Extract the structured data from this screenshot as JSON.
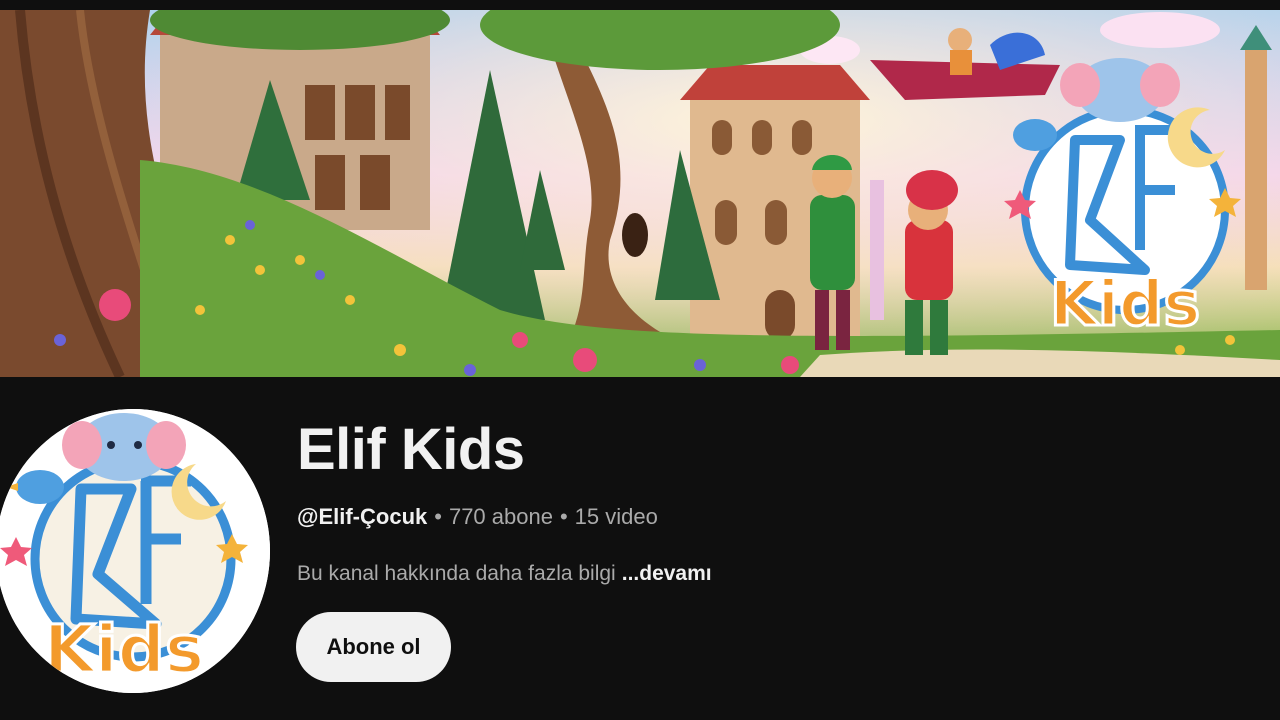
{
  "banner": {
    "logo_text": "Kids",
    "logo_letters": "Elif"
  },
  "avatar": {
    "logo_text": "Kids"
  },
  "channel": {
    "name": "Elif Kids",
    "handle": "@Elif-Çocuk",
    "separator": "•",
    "subscribers": "770 abone",
    "videos": "15 video",
    "description": "Bu kanal hakkında daha fazla bilgi",
    "more_label": "...devamı"
  },
  "actions": {
    "subscribe_label": "Abone ol"
  },
  "colors": {
    "background": "#0f0f0f",
    "primary_text": "#f1f1f1",
    "secondary_text": "#aaaaaa",
    "button_bg": "#f1f1f1",
    "logo_blue": "#3b8fd6"
  },
  "icons": [
    "elephant-icon",
    "bird-icon",
    "moon-icon",
    "star-icon"
  ]
}
